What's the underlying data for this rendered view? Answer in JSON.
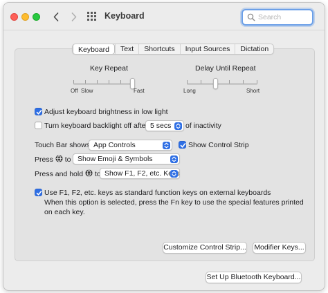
{
  "window": {
    "title": "Keyboard",
    "search_placeholder": "Search"
  },
  "tabs": [
    "Keyboard",
    "Text",
    "Shortcuts",
    "Input Sources",
    "Dictation"
  ],
  "active_tab": "Keyboard",
  "key_repeat": {
    "label": "Key Repeat",
    "left_labels": [
      "Off",
      "Slow"
    ],
    "right_label": "Fast",
    "level": 1.0
  },
  "delay_repeat": {
    "label": "Delay Until Repeat",
    "left_label": "Long",
    "right_label": "Short",
    "level": 0.4
  },
  "options": {
    "adjust_brightness": {
      "label": "Adjust keyboard brightness in low light",
      "checked": true
    },
    "backlight_off": {
      "label": "Turn keyboard backlight off after",
      "checked": false,
      "value": "5 secs",
      "suffix": "of inactivity"
    },
    "touch_bar": {
      "label": "Touch Bar shows",
      "value": "App Controls"
    },
    "show_control_strip": {
      "label": "Show Control Strip",
      "checked": true
    },
    "press_globe": {
      "prefix": "Press",
      "suffix": "to",
      "value": "Show Emoji & Symbols"
    },
    "press_hold_globe": {
      "prefix": "Press and hold",
      "suffix": "to",
      "value": "Show F1, F2, etc. Keys"
    },
    "fn_keys": {
      "label": "Use F1, F2, etc. keys as standard function keys on external keyboards",
      "checked": true,
      "description": "When this option is selected, press the Fn key to use the special features printed on each key."
    }
  },
  "buttons": {
    "customize_control_strip": "Customize Control Strip...",
    "modifier_keys": "Modifier Keys...",
    "bluetooth_keyboard": "Set Up Bluetooth Keyboard..."
  },
  "colors": {
    "accent": "#2f6fe4",
    "window_bg": "#ececec",
    "panel_bg": "#e3e3e3"
  }
}
